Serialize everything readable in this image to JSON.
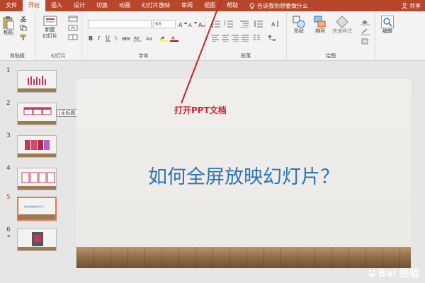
{
  "ribbon_tabs": [
    "文件",
    "开始",
    "插入",
    "设计",
    "切换",
    "动画",
    "幻灯片放映",
    "审阅",
    "视图",
    "帮助"
  ],
  "tell_me": "告诉我你想要做什么",
  "share": "共享",
  "clipboard": {
    "paste": "粘贴",
    "group": "剪贴板"
  },
  "slides_group": {
    "new_slide": "新建\n幻灯片",
    "group": "幻灯片"
  },
  "font_group": {
    "size": "66",
    "group": "字体"
  },
  "paragraph_group": {
    "group": "段落"
  },
  "drawing_group": {
    "shape": "形状",
    "arrange": "排列",
    "quick_styles": "快速样式",
    "group": "绘图"
  },
  "editing_group": {
    "edit": "编辑"
  },
  "thumbnails": [
    {
      "num": "1"
    },
    {
      "num": "2"
    },
    {
      "num": "3"
    },
    {
      "num": "4"
    },
    {
      "num": "5",
      "selected": true
    },
    {
      "num": "6",
      "star": "*"
    }
  ],
  "tooltip": "[无标题]",
  "thumb5_text": "如何全屏放映幻灯片？",
  "slide_title": "如何全屏放映幻灯片？",
  "annotation": "打开PPT文档",
  "watermark": "Bai 经验",
  "colors": {
    "accent": "#b7472a",
    "title_blue": "#2e75b6",
    "annotation_red": "#c0272d"
  }
}
